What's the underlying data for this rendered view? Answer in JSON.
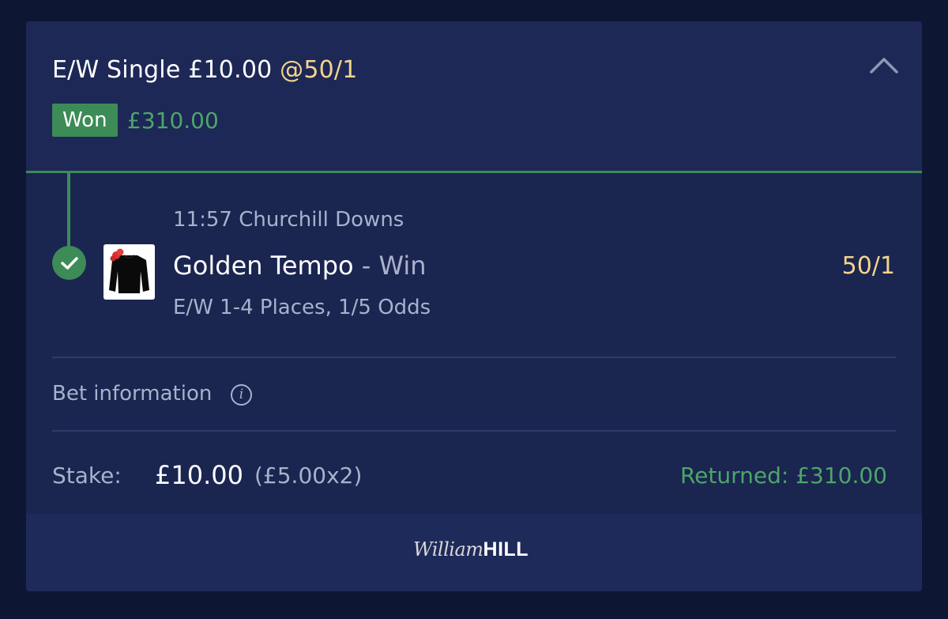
{
  "bet": {
    "title_prefix": "E/W Single £10.00",
    "title_odds": "@50/1",
    "status_badge": "Won",
    "winnings": "£310.00"
  },
  "leg": {
    "race": "11:57 Churchill Downs",
    "horse": "Golden Tempo",
    "separator": " - ",
    "market": "Win",
    "odds": "50/1",
    "ew_terms": "E/W 1-4 Places, 1/5 Odds"
  },
  "info": {
    "label": "Bet information",
    "icon": "i"
  },
  "summary": {
    "stake_label": "Stake:",
    "stake_value": "£10.00",
    "stake_split": "(£5.00x2)",
    "returned": "Returned: £310.00"
  },
  "footer": {
    "logo_script": "William",
    "logo_bold": "HILL"
  },
  "colors": {
    "background": "#0d1733",
    "card": "#1a2550",
    "won_green": "#3d8b57",
    "odds_gold": "#f3d48b",
    "muted_text": "#a9b1cc"
  },
  "icons": [
    "chevron-up-icon",
    "check-icon",
    "jockey-silk-icon",
    "info-icon"
  ]
}
